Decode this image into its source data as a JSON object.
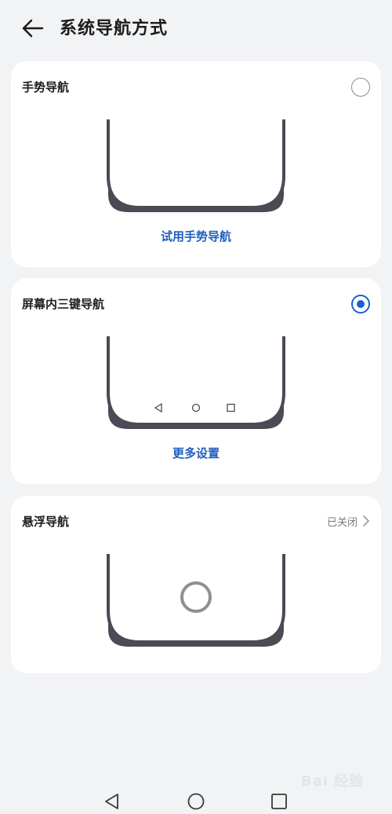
{
  "header": {
    "title": "系统导航方式"
  },
  "options": [
    {
      "title": "手势导航",
      "link": "试用手势导航"
    },
    {
      "title": "屏幕内三键导航",
      "link": "更多设置"
    },
    {
      "title": "悬浮导航",
      "status": "已关闭"
    }
  ],
  "selected_option": "屏幕内三键导航",
  "watermark": "Bai 经验",
  "colors": {
    "accent": "#1a5fd6",
    "link": "#1f5fbf",
    "background": "#f1f3f5",
    "card": "#ffffff",
    "phone_frame": "#4a4b54"
  },
  "icons": [
    "back-arrow-icon",
    "nav-back-icon",
    "nav-home-icon",
    "nav-recents-icon",
    "chevron-right-icon",
    "floating-nav-ring-icon"
  ]
}
